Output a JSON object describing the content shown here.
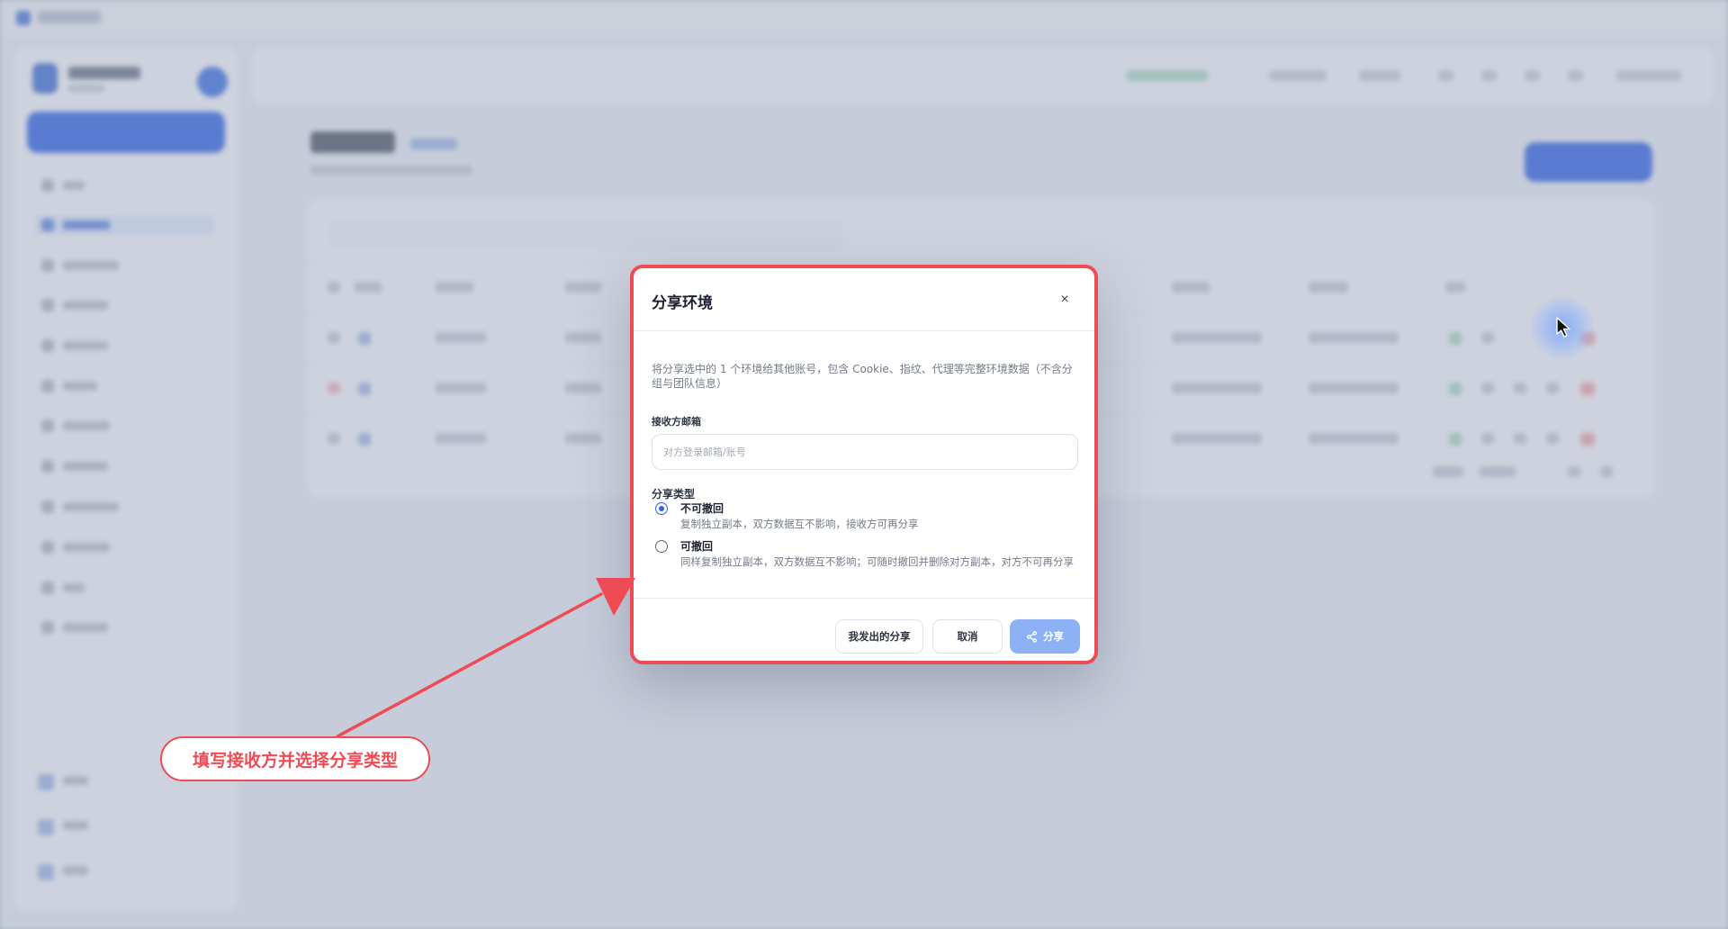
{
  "dialog": {
    "title": "分享环境",
    "close_glyph": "×",
    "description": "将分享选中的 1 个环境给其他账号，包含 Cookie、指纹、代理等完整环境数据（不含分组与团队信息）",
    "recipient_label": "接收方邮箱",
    "recipient_placeholder": "对方登录邮箱/账号",
    "recipient_value": "",
    "share_type_label": "分享类型",
    "options": [
      {
        "title": "不可撤回",
        "desc": "复制独立副本，双方数据互不影响，接收方可再分享",
        "selected": true
      },
      {
        "title": "可撤回",
        "desc": "同样复制独立副本，双方数据互不影响；可随时撤回并删除对方副本，对方不可再分享",
        "selected": false
      }
    ],
    "buttons": {
      "my_shares": "我发出的分享",
      "cancel": "取消",
      "share": "分享"
    }
  },
  "annotation": {
    "text": "填写接收方并选择分享类型"
  },
  "colors": {
    "accent": "#2f62e4",
    "annotation_red": "#ef4b55",
    "share_button": "#8cb2f5"
  }
}
